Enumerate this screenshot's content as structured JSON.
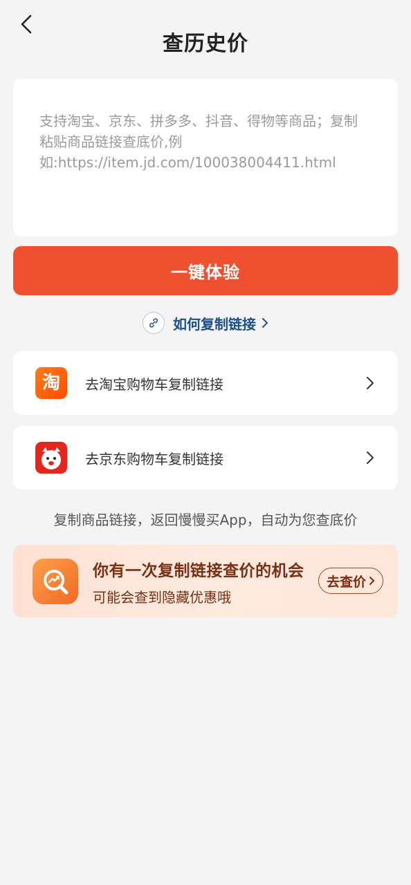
{
  "header": {
    "title": "查历史价",
    "back_icon": "chevron-left-icon"
  },
  "input": {
    "placeholder": "支持淘宝、京东、拼多多、抖音、得物等商品；复制粘贴商品链接查底价,例如:https://item.jd.com/100038004411.html",
    "value": ""
  },
  "cta": {
    "label": "一键体验",
    "color": "#ef5030"
  },
  "help": {
    "icon": "link-icon",
    "label": "如何复制链接",
    "color": "#1d4f8c"
  },
  "rows": [
    {
      "icon": "taobao-app-icon",
      "icon_text": "淘",
      "label": "去淘宝购物车复制链接"
    },
    {
      "icon": "jd-app-icon",
      "label": "去京东购物车复制链接"
    }
  ],
  "note": "复制商品链接，返回慢慢买App，自动为您查底价",
  "promo": {
    "icon": "price-trend-icon",
    "title": "你有一次复制链接查价的机会",
    "subtitle": "可能会查到隐藏优惠哦",
    "button_label": "去查价"
  }
}
